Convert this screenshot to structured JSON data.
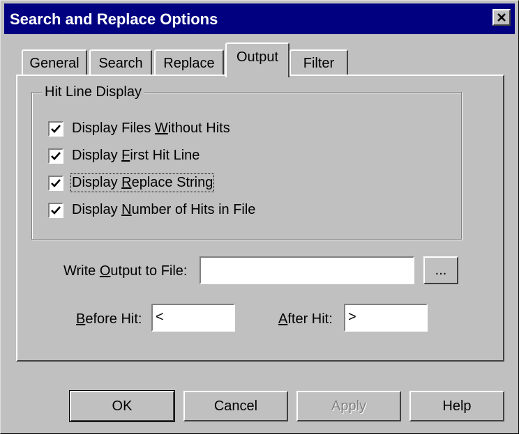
{
  "window": {
    "title": "Search and Replace Options",
    "close_icon": "close-icon"
  },
  "tabs": [
    {
      "label": "General",
      "active": false
    },
    {
      "label": "Search",
      "active": false
    },
    {
      "label": "Replace",
      "active": false
    },
    {
      "label": "Output",
      "active": true
    },
    {
      "label": "Filter",
      "active": false
    }
  ],
  "hit_line_display": {
    "group_label": "Hit Line Display",
    "options": [
      {
        "pre": "Display Files ",
        "mnemonic": "W",
        "post": "ithout Hits",
        "checked": true
      },
      {
        "pre": "Display ",
        "mnemonic": "F",
        "post": "irst Hit Line",
        "checked": true
      },
      {
        "pre": "Display ",
        "mnemonic": "R",
        "post": "eplace String",
        "checked": true,
        "focused": true
      },
      {
        "pre": "Display ",
        "mnemonic": "N",
        "post": "umber of Hits in File",
        "checked": true
      }
    ]
  },
  "output_file": {
    "label_pre": "Write ",
    "label_mnemonic": "O",
    "label_post": "utput to File:",
    "value": "",
    "browse_label": "..."
  },
  "before_hit": {
    "label_mnemonic": "B",
    "label_post": "efore Hit:",
    "value": "<"
  },
  "after_hit": {
    "label_mnemonic": "A",
    "label_post": "fter Hit:",
    "value": ">"
  },
  "buttons": {
    "ok": "OK",
    "cancel": "Cancel",
    "apply": "Apply",
    "help": "Help"
  },
  "colors": {
    "titlebar": "#000080",
    "face": "#c0c0c0"
  }
}
